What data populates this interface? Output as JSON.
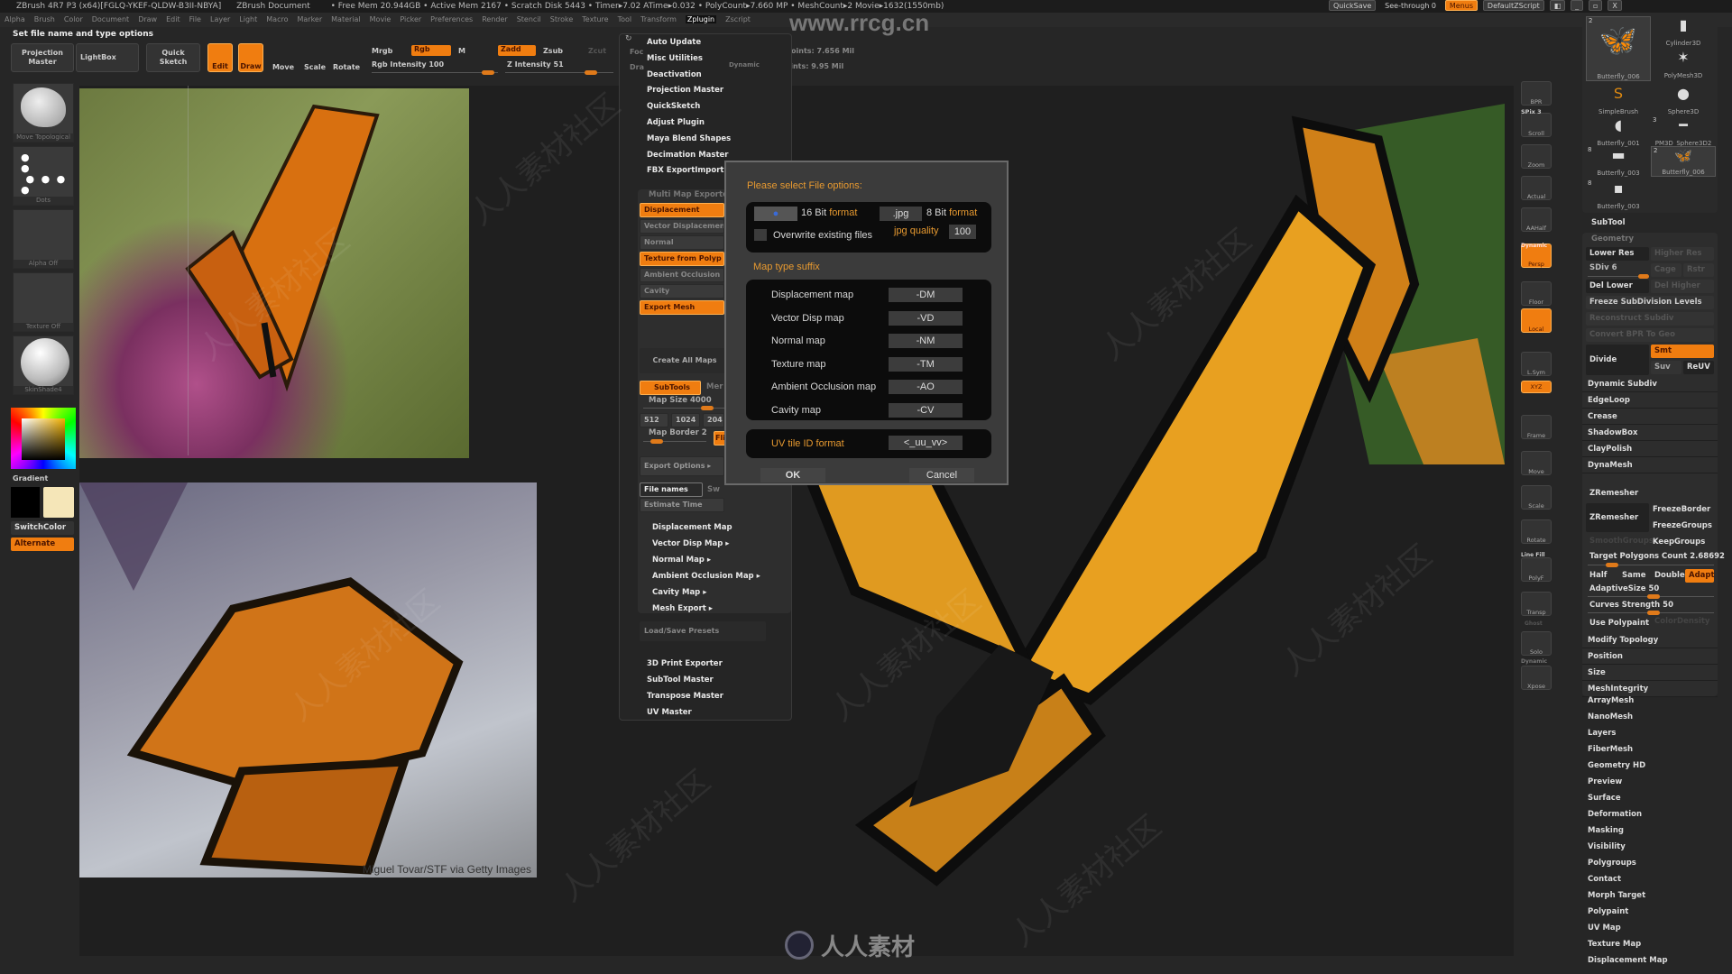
{
  "title_bar": {
    "app": "ZBrush 4R7 P3 (x64)[FGLQ-YKEF-QLDW-B3II-NBYA]",
    "document": "ZBrush Document",
    "stats": "• Free Mem 20.944GB • Active Mem 2167 • Scratch Disk 5443 • Timer▸7.02 ATime▸0.032 • PolyCount▸7.660 MP • MeshCount▸2  Movie▸1632(1550mb)",
    "quicksave": "QuickSave",
    "see_through": "See-through  0",
    "menus": "Menus",
    "default_zscript": "DefaultZScript"
  },
  "menubar": [
    "Alpha",
    "Brush",
    "Color",
    "Document",
    "Draw",
    "Edit",
    "File",
    "Layer",
    "Light",
    "Macro",
    "Marker",
    "Material",
    "Movie",
    "Picker",
    "Preferences",
    "Render",
    "Stencil",
    "Stroke",
    "Texture",
    "Tool",
    "Transform",
    "Zplugin",
    "Zscript"
  ],
  "status": "Set file name and type options",
  "watermark": "www.rrcg.cn",
  "bottom_logo": "人人素材",
  "top_shelf": {
    "projection_master": "Projection Master",
    "lightbox": "LightBox",
    "quick_sketch": "Quick Sketch",
    "edit": "Edit",
    "draw": "Draw",
    "move": "Move",
    "scale": "Scale",
    "rotate": "Rotate",
    "mrgb": "Mrgb",
    "rgb": "Rgb",
    "m": "M",
    "rgb_intensity": "Rgb Intensity 100",
    "zadd": "Zadd",
    "zsub": "Zsub",
    "zcut": "Zcut",
    "z_intensity": "Z Intensity 51",
    "focal": "Foc",
    "drawsize": "Dra",
    "dynamic": "Dynamic",
    "active_points": "ActivePoints: 7.656 Mil",
    "total_points": "TotalPoints: 9.95 Mil"
  },
  "left_shelf": {
    "brush": "Move Topological",
    "stroke": "Dots",
    "alpha": "Alpha Off",
    "texture": "Texture Off",
    "material": "SkinShade4",
    "gradient": "Gradient",
    "switch_color": "SwitchColor",
    "alternate": "Alternate",
    "main_color": "#000000",
    "secondary_color": "#f5e6b8"
  },
  "photo_caption": "Miguel Tovar/STF via Getty Images",
  "zplugin": {
    "top_items": [
      "Auto Update",
      "Misc Utilities",
      "Deactivation",
      "Projection Master",
      "QuickSketch",
      "Adjust Plugin",
      "Maya Blend Shapes",
      "Decimation Master",
      "FBX ExportImport"
    ],
    "mme_title": "Multi Map Exporter",
    "mme_toggles": [
      {
        "label": "Displacement",
        "on": true
      },
      {
        "label": "Vector Displacemen",
        "on": false
      },
      {
        "label": "Normal",
        "on": false
      },
      {
        "label": "Texture from Polyp",
        "on": true
      },
      {
        "label": "Ambient Occlusion",
        "on": false
      },
      {
        "label": "Cavity",
        "on": false
      },
      {
        "label": "Export Mesh",
        "on": true
      }
    ],
    "create_all": "Create All Maps",
    "subtools": "SubTools",
    "merge": "Mer",
    "map_size": "Map Size 4000",
    "sizes": [
      "512",
      "1024",
      "204"
    ],
    "map_border": "Map Border 2",
    "flip": "Fli",
    "export_options": "Export Options ▸",
    "file_names": "File names",
    "sw": "Sw",
    "estimate_time": "Estimate Time",
    "sub_items": [
      "Displacement Map",
      "Vector Disp Map ▸",
      "Normal Map ▸",
      "Ambient Occlusion Map ▸",
      "Cavity Map ▸",
      "Mesh Export ▸"
    ],
    "presets": "Load/Save Presets",
    "bottom_items": [
      "3D Print Exporter",
      "SubTool Master",
      "Transpose Master",
      "UV Master"
    ]
  },
  "dialog": {
    "title": "Please select File options:",
    "bit16_num": "16 Bit",
    "bit16_fmt": "format",
    "jpg": ".jpg",
    "bit8_num": "8 Bit",
    "bit8_fmt": "format",
    "overwrite": "Overwrite existing files",
    "overwrite_checked": false,
    "jpg_quality_label": "jpg quality",
    "jpg_quality": "100",
    "suffix_title": "Map type suffix",
    "suffixes": [
      {
        "label": "Displacement map",
        "value": "-DM"
      },
      {
        "label": "Vector Disp map",
        "value": "-VD"
      },
      {
        "label": "Normal map",
        "value": "-NM"
      },
      {
        "label": "Texture map",
        "value": "-TM"
      },
      {
        "label": "Ambient Occlusion map",
        "value": "-AO"
      },
      {
        "label": "Cavity map",
        "value": "-CV"
      }
    ],
    "uv_label": "UV tile ID format",
    "uv_value": "<_uu_vv>",
    "ok": "OK",
    "cancel": "Cancel"
  },
  "right_shelf": [
    "BPR",
    "Scroll",
    "Zoom",
    "Actual",
    "AAHalf",
    "Persp",
    "Floor",
    "Local",
    "L.Sym",
    "XYZ",
    "Frame",
    "Move",
    "Scale",
    "Rotate",
    "PolyF",
    "Transp",
    "Solo",
    "Xpose"
  ],
  "right_shelf_extra": {
    "spix": "SPix 3",
    "dynamic": "Dynamic",
    "line_fill": "Line Fill",
    "ghost": "Ghost",
    "dynamic2": "Dynamic"
  },
  "tools": [
    {
      "name": "Butterfly_006",
      "count": "2"
    },
    {
      "name": "Cylinder3D",
      "count": ""
    },
    {
      "name": "PolyMesh3D",
      "count": ""
    },
    {
      "name": "SimpleBrush",
      "count": ""
    },
    {
      "name": "Sphere3D",
      "count": ""
    },
    {
      "name": "Butterfly_001",
      "count": ""
    },
    {
      "name": "PM3D_Sphere3D2",
      "count": "3"
    },
    {
      "name": "Butterfly_003",
      "count": "8"
    },
    {
      "name": "Butterfly_006",
      "count": "2"
    },
    {
      "name": "Butterfly_003",
      "count": "8"
    }
  ],
  "subtool": {
    "title": "SubTool",
    "geometry": "Geometry",
    "lower_res": "Lower Res",
    "higher_res": "Higher Res",
    "sdiv": "SDiv 6",
    "cage": "Cage",
    "rstr": "Rstr",
    "del_lower": "Del Lower",
    "del_higher": "Del Higher",
    "freeze": "Freeze SubDivision Levels",
    "reconstruct": "Reconstruct Subdiv",
    "convert": "Convert BPR To Geo",
    "divide": "Divide",
    "smt": "Smt",
    "suv": "Suv",
    "reuv": "ReUV",
    "geo_items": [
      "Dynamic Subdiv",
      "EdgeLoop",
      "Crease",
      "ShadowBox",
      "ClayPolish",
      "DynaMesh"
    ],
    "zremesher": "ZRemesher",
    "zremesher_btn": "ZRemesher",
    "freeze_border": "FreezeBorder",
    "freeze_groups": "FreezeGroups",
    "smooth_groups": "SmoothGroups",
    "keep_groups": "KeepGroups",
    "target": "Target Polygons Count 2.68692",
    "half": "Half",
    "same": "Same",
    "double": "Double",
    "adapt": "Adapt",
    "adaptive_size": "AdaptiveSize 50",
    "curves": "Curves Strength 50",
    "use_polypaint": "Use Polypaint",
    "color_density": "ColorDensity",
    "more_items": [
      "Modify Topology",
      "Position",
      "Size",
      "MeshIntegrity"
    ]
  },
  "tool_sections": [
    "ArrayMesh",
    "NanoMesh",
    "Layers",
    "FiberMesh",
    "Geometry HD",
    "Preview",
    "Surface",
    "Deformation",
    "Masking",
    "Visibility",
    "Polygroups",
    "Contact",
    "Morph Target",
    "Polypaint",
    "UV Map",
    "Texture Map",
    "Displacement Map"
  ]
}
